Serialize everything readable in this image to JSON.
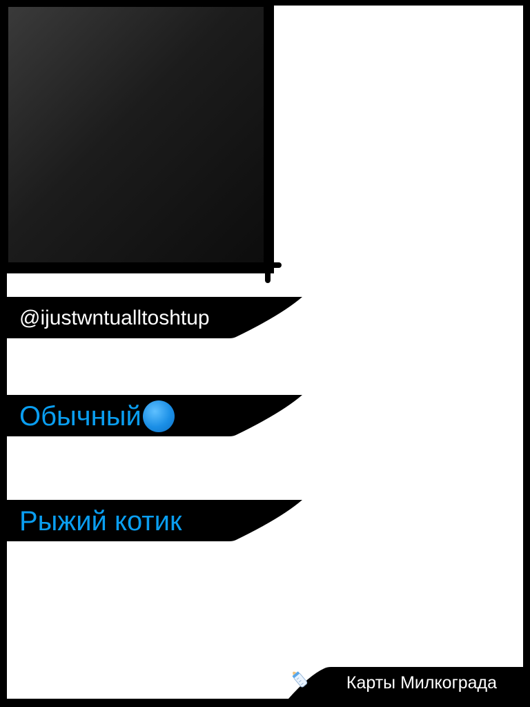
{
  "profile": {
    "username": "@ijustwntualltoshtup",
    "type_label": "Обычный",
    "type_dot_icon": "blue-circle-icon",
    "name_label": "Рыжий котик",
    "photo_placeholder": ""
  },
  "footer": {
    "label": "Карты Милкограда",
    "icon": "baby-bottle-icon"
  },
  "colors": {
    "accent_text": "#0a9ef0",
    "banner_bg": "#000000",
    "card_bg": "#ffffff"
  }
}
